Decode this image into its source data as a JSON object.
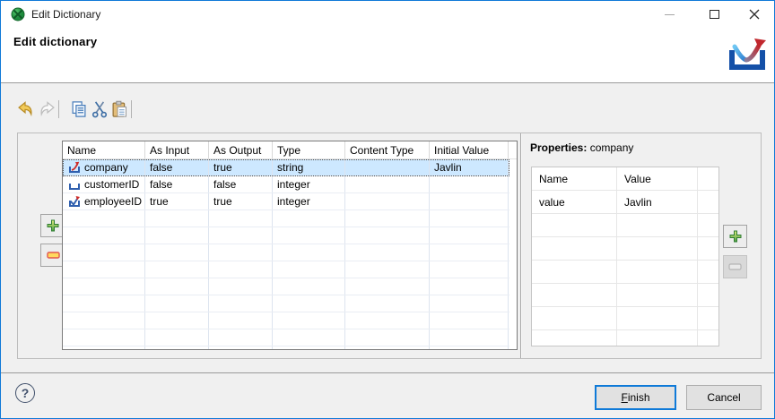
{
  "window": {
    "title": "Edit Dictionary"
  },
  "header": {
    "title": "Edit dictionary"
  },
  "toolbar": {
    "buttons": [
      {
        "name": "undo",
        "enabled": true
      },
      {
        "name": "redo",
        "enabled": false
      },
      {
        "name": "copy",
        "enabled": true
      },
      {
        "name": "cut",
        "enabled": true
      },
      {
        "name": "paste",
        "enabled": true
      }
    ]
  },
  "dictionary_table": {
    "columns": [
      "Name",
      "As Input",
      "As Output",
      "Type",
      "Content Type",
      "Initial Value"
    ],
    "rows": [
      {
        "icon": "dictionary-entry-output",
        "name": "company",
        "as_input": "false",
        "as_output": "true",
        "type": "string",
        "content_type": "",
        "initial_value": "Javlin",
        "selected": true
      },
      {
        "icon": "dictionary-entry",
        "name": "customerID",
        "as_input": "false",
        "as_output": "false",
        "type": "integer",
        "content_type": "",
        "initial_value": "",
        "selected": false
      },
      {
        "icon": "dictionary-entry-in-out",
        "name": "employeeID",
        "as_input": "true",
        "as_output": "true",
        "type": "integer",
        "content_type": "",
        "initial_value": "",
        "selected": false
      }
    ]
  },
  "properties": {
    "label": "Properties:",
    "entry_name": "company",
    "columns": [
      "Name",
      "Value"
    ],
    "rows": [
      {
        "name": "value",
        "value": "Javlin"
      }
    ]
  },
  "footer": {
    "help": "?",
    "finish_accel": "F",
    "finish_rest": "inish",
    "cancel_label": "Cancel"
  },
  "colors": {
    "accent_blue": "#0f7ad8",
    "selection_blue": "#cde8ff",
    "plus_green": "#4da64d",
    "minus_red": "#e2574c",
    "entry_icon_blue": "#2f5fae",
    "entry_icon_red": "#cf2a27",
    "logo_blue": "#1450a8",
    "logo_red": "#c1272d",
    "undo_gold": "#f2cb5a"
  }
}
